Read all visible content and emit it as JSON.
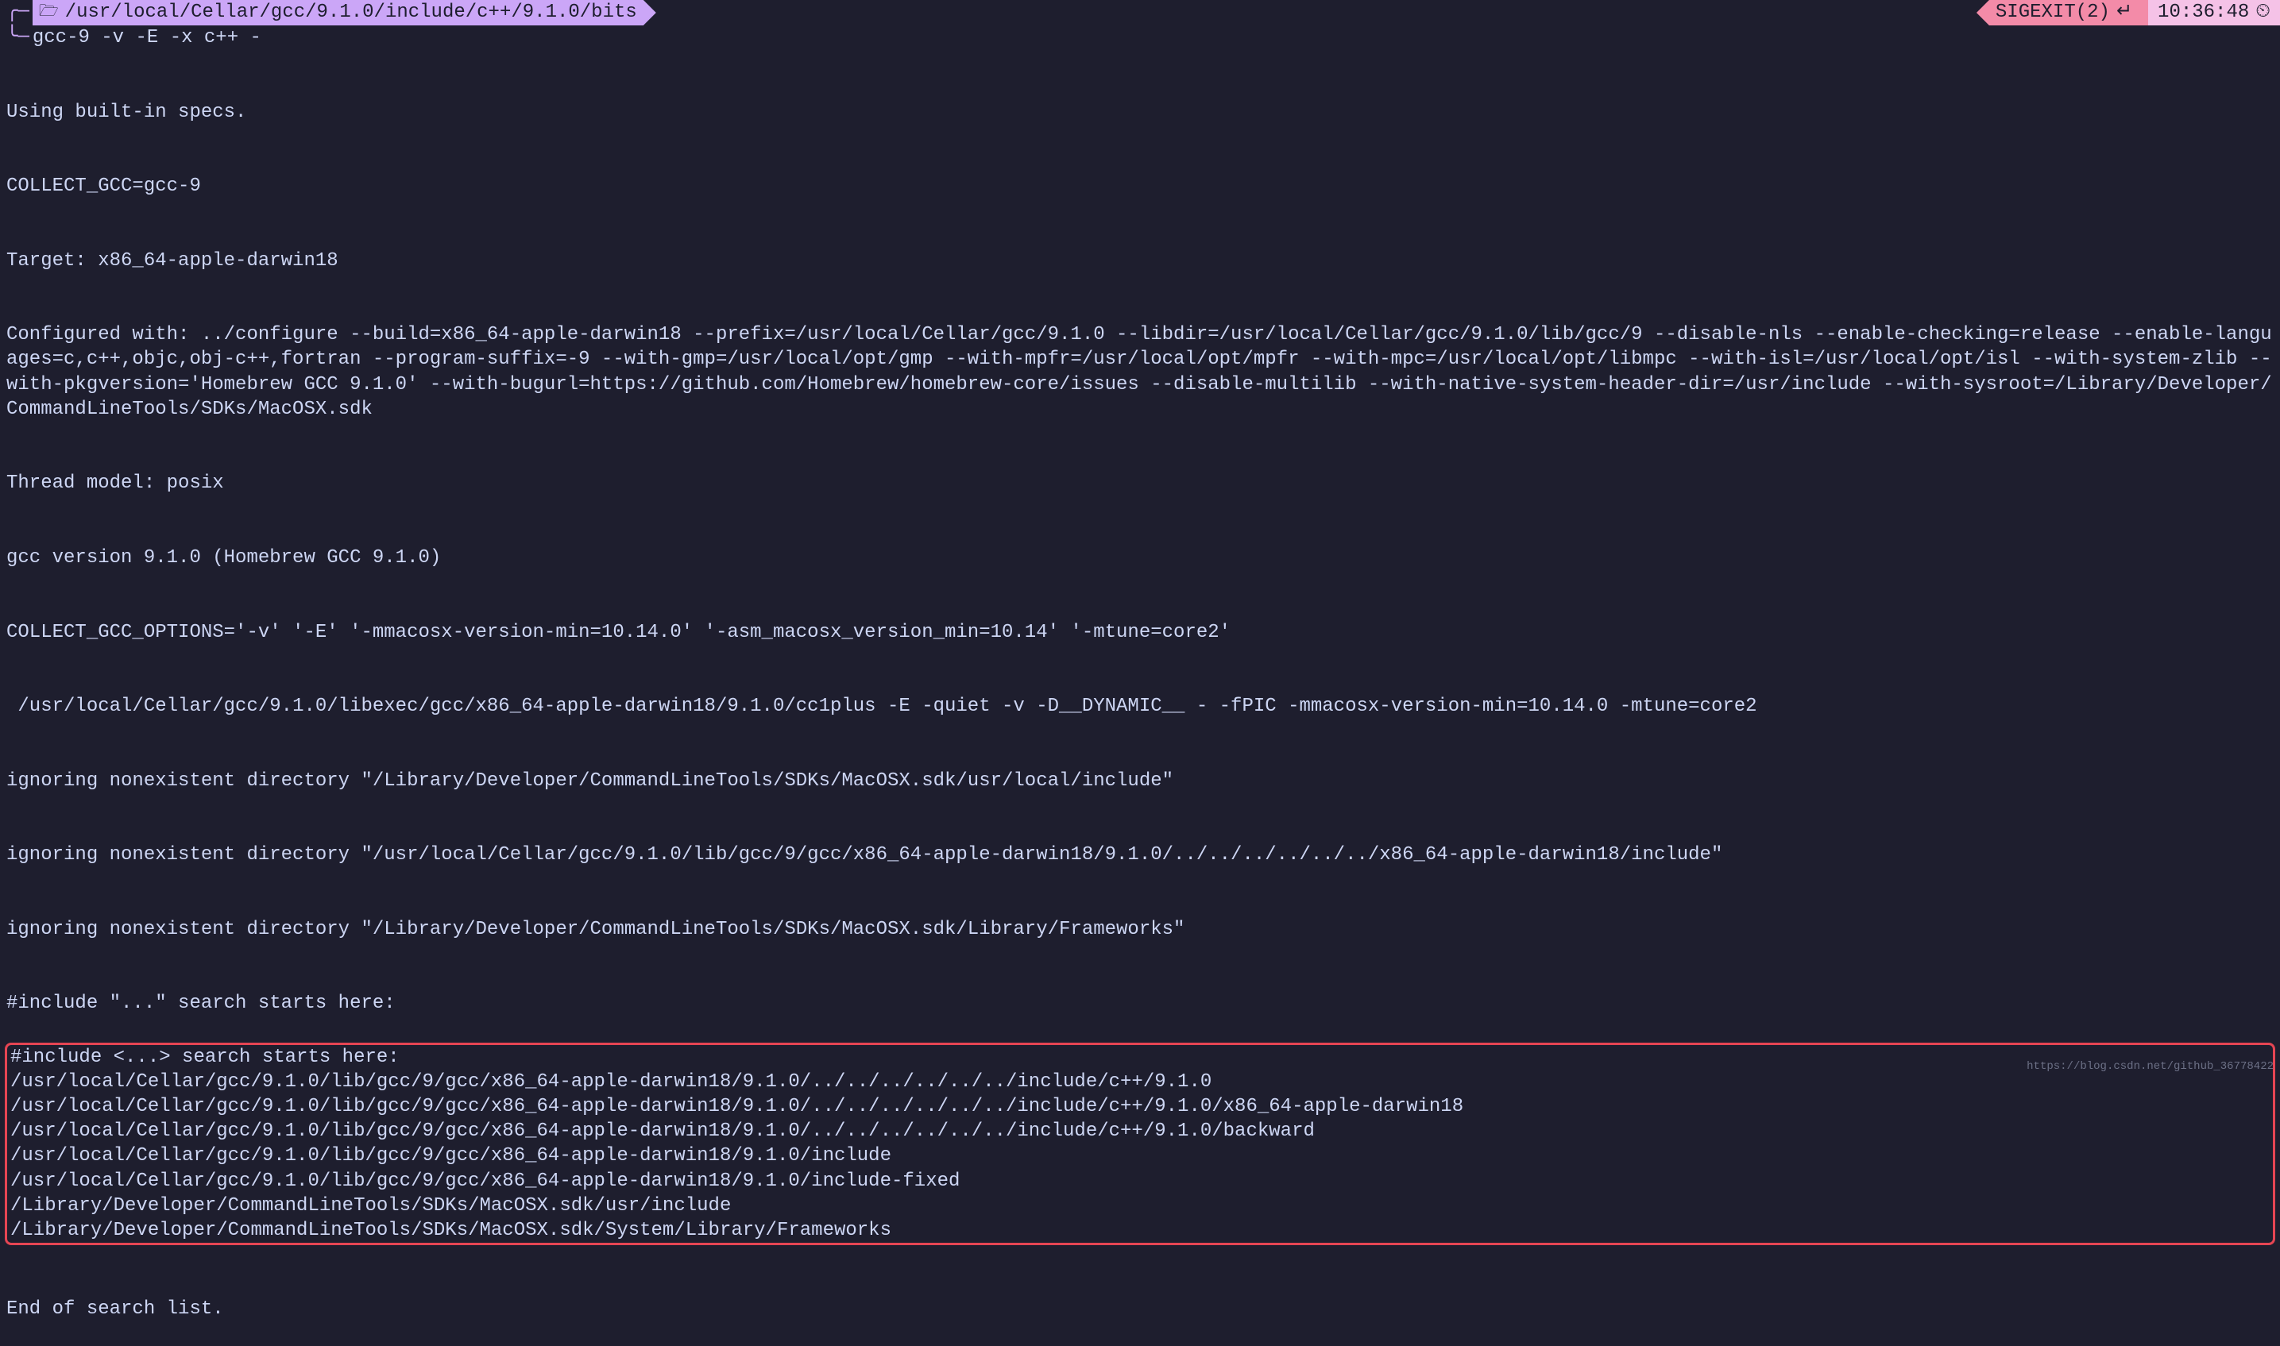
{
  "statusbar": {
    "path_prefix_icon": "❯",
    "folder_icon": "🗁",
    "path": "/usr/local/Cellar/gcc/9.1.0/include/c++/9.1.0/bits",
    "sigexit_label": "SIGEXIT(2)",
    "return_icon": "↵",
    "time": "10:36:48",
    "clock_icon": "⏲"
  },
  "prompt": {
    "connector": "└─",
    "command": "gcc-9 -v -E -x c++ -"
  },
  "output": {
    "lines": [
      "Using built-in specs.",
      "COLLECT_GCC=gcc-9",
      "Target: x86_64-apple-darwin18",
      "Configured with: ../configure --build=x86_64-apple-darwin18 --prefix=/usr/local/Cellar/gcc/9.1.0 --libdir=/usr/local/Cellar/gcc/9.1.0/lib/gcc/9 --disable-nls --enable-checking=release --enable-languages=c,c++,objc,obj-c++,fortran --program-suffix=-9 --with-gmp=/usr/local/opt/gmp --with-mpfr=/usr/local/opt/mpfr --with-mpc=/usr/local/opt/libmpc --with-isl=/usr/local/opt/isl --with-system-zlib --with-pkgversion='Homebrew GCC 9.1.0' --with-bugurl=https://github.com/Homebrew/homebrew-core/issues --disable-multilib --with-native-system-header-dir=/usr/include --with-sysroot=/Library/Developer/CommandLineTools/SDKs/MacOSX.sdk",
      "Thread model: posix",
      "gcc version 9.1.0 (Homebrew GCC 9.1.0)",
      "COLLECT_GCC_OPTIONS='-v' '-E' '-mmacosx-version-min=10.14.0' '-asm_macosx_version_min=10.14' '-mtune=core2'",
      " /usr/local/Cellar/gcc/9.1.0/libexec/gcc/x86_64-apple-darwin18/9.1.0/cc1plus -E -quiet -v -D__DYNAMIC__ - -fPIC -mmacosx-version-min=10.14.0 -mtune=core2",
      "ignoring nonexistent directory \"/Library/Developer/CommandLineTools/SDKs/MacOSX.sdk/usr/local/include\"",
      "ignoring nonexistent directory \"/usr/local/Cellar/gcc/9.1.0/lib/gcc/9/gcc/x86_64-apple-darwin18/9.1.0/../../../../../../x86_64-apple-darwin18/include\"",
      "ignoring nonexistent directory \"/Library/Developer/CommandLineTools/SDKs/MacOSX.sdk/Library/Frameworks\"",
      "#include \"...\" search starts here:"
    ],
    "highlighted_lines": [
      "#include <...> search starts here:",
      " /usr/local/Cellar/gcc/9.1.0/lib/gcc/9/gcc/x86_64-apple-darwin18/9.1.0/../../../../../../include/c++/9.1.0",
      " /usr/local/Cellar/gcc/9.1.0/lib/gcc/9/gcc/x86_64-apple-darwin18/9.1.0/../../../../../../include/c++/9.1.0/x86_64-apple-darwin18",
      " /usr/local/Cellar/gcc/9.1.0/lib/gcc/9/gcc/x86_64-apple-darwin18/9.1.0/../../../../../../include/c++/9.1.0/backward",
      " /usr/local/Cellar/gcc/9.1.0/lib/gcc/9/gcc/x86_64-apple-darwin18/9.1.0/include",
      " /usr/local/Cellar/gcc/9.1.0/lib/gcc/9/gcc/x86_64-apple-darwin18/9.1.0/include-fixed",
      " /Library/Developer/CommandLineTools/SDKs/MacOSX.sdk/usr/include",
      " /Library/Developer/CommandLineTools/SDKs/MacOSX.sdk/System/Library/Frameworks"
    ],
    "after_lines": [
      "End of search list."
    ]
  },
  "watermark": "https://blog.csdn.net/github_36778422"
}
